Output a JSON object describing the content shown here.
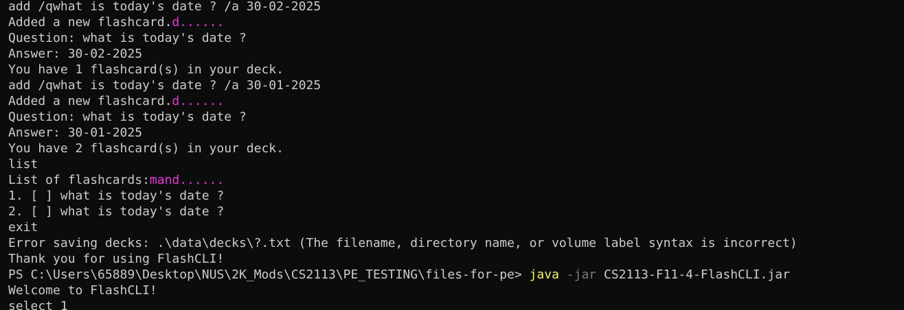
{
  "terminal": {
    "colors": {
      "background": "#0c0c0c",
      "text": "#cccccc",
      "magenta": "#e33ad8",
      "command": "#f2f26a",
      "flag": "#7a7a7a"
    },
    "lines": [
      {
        "segments": [
          {
            "text": "add /qwhat is today's date ? /a 30-02-2025",
            "color": "default"
          }
        ]
      },
      {
        "segments": [
          {
            "text": "Added a new flashcard.",
            "color": "default"
          },
          {
            "text": "d......",
            "color": "magenta"
          }
        ]
      },
      {
        "segments": [
          {
            "text": "Question: what is today's date ?",
            "color": "default"
          }
        ]
      },
      {
        "segments": [
          {
            "text": "Answer: 30-02-2025",
            "color": "default"
          }
        ]
      },
      {
        "segments": [
          {
            "text": "You have 1 flashcard(s) in your deck.",
            "color": "default"
          }
        ]
      },
      {
        "segments": [
          {
            "text": "add /qwhat is today's date ? /a 30-01-2025",
            "color": "default"
          }
        ]
      },
      {
        "segments": [
          {
            "text": "Added a new flashcard.",
            "color": "default"
          },
          {
            "text": "d......",
            "color": "magenta"
          }
        ]
      },
      {
        "segments": [
          {
            "text": "Question: what is today's date ?",
            "color": "default"
          }
        ]
      },
      {
        "segments": [
          {
            "text": "Answer: 30-01-2025",
            "color": "default"
          }
        ]
      },
      {
        "segments": [
          {
            "text": "You have 2 flashcard(s) in your deck.",
            "color": "default"
          }
        ]
      },
      {
        "segments": [
          {
            "text": "list",
            "color": "default"
          }
        ]
      },
      {
        "segments": [
          {
            "text": "List of flashcards:",
            "color": "default"
          },
          {
            "text": "mand......",
            "color": "magenta"
          }
        ]
      },
      {
        "segments": [
          {
            "text": "1. [ ] what is today's date ?",
            "color": "default"
          }
        ]
      },
      {
        "segments": [
          {
            "text": "2. [ ] what is today's date ?",
            "color": "default"
          }
        ]
      },
      {
        "segments": [
          {
            "text": "exit",
            "color": "default"
          }
        ]
      },
      {
        "segments": [
          {
            "text": "Error saving decks: .\\data\\decks\\?.txt (The filename, directory name, or volume label syntax is incorrect)",
            "color": "default"
          }
        ]
      },
      {
        "segments": [
          {
            "text": "Thank you for using FlashCLI!",
            "color": "default"
          }
        ]
      },
      {
        "segments": [
          {
            "text": "PS C:\\Users\\65889\\Desktop\\NUS\\2K_Mods\\CS2113\\PE_TESTING\\files-for-pe> ",
            "color": "default"
          },
          {
            "text": "java",
            "color": "yellow"
          },
          {
            "text": " -jar",
            "color": "gray"
          },
          {
            "text": " CS2113-F11-4-FlashCLI.jar",
            "color": "default"
          }
        ]
      },
      {
        "segments": [
          {
            "text": "Welcome to FlashCLI!",
            "color": "default"
          }
        ]
      },
      {
        "segments": [
          {
            "text": "select 1",
            "color": "default"
          }
        ]
      }
    ]
  }
}
